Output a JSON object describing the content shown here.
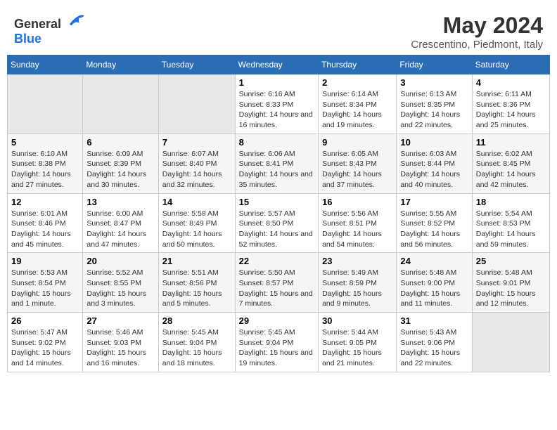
{
  "header": {
    "logo_general": "General",
    "logo_blue": "Blue",
    "title": "May 2024",
    "subtitle": "Crescentino, Piedmont, Italy"
  },
  "weekdays": [
    "Sunday",
    "Monday",
    "Tuesday",
    "Wednesday",
    "Thursday",
    "Friday",
    "Saturday"
  ],
  "weeks": [
    [
      {
        "day": "",
        "empty": true
      },
      {
        "day": "",
        "empty": true
      },
      {
        "day": "",
        "empty": true
      },
      {
        "day": "1",
        "sunrise": "6:16 AM",
        "sunset": "8:33 PM",
        "daylight": "14 hours and 16 minutes."
      },
      {
        "day": "2",
        "sunrise": "6:14 AM",
        "sunset": "8:34 PM",
        "daylight": "14 hours and 19 minutes."
      },
      {
        "day": "3",
        "sunrise": "6:13 AM",
        "sunset": "8:35 PM",
        "daylight": "14 hours and 22 minutes."
      },
      {
        "day": "4",
        "sunrise": "6:11 AM",
        "sunset": "8:36 PM",
        "daylight": "14 hours and 25 minutes."
      }
    ],
    [
      {
        "day": "5",
        "sunrise": "6:10 AM",
        "sunset": "8:38 PM",
        "daylight": "14 hours and 27 minutes."
      },
      {
        "day": "6",
        "sunrise": "6:09 AM",
        "sunset": "8:39 PM",
        "daylight": "14 hours and 30 minutes."
      },
      {
        "day": "7",
        "sunrise": "6:07 AM",
        "sunset": "8:40 PM",
        "daylight": "14 hours and 32 minutes."
      },
      {
        "day": "8",
        "sunrise": "6:06 AM",
        "sunset": "8:41 PM",
        "daylight": "14 hours and 35 minutes."
      },
      {
        "day": "9",
        "sunrise": "6:05 AM",
        "sunset": "8:43 PM",
        "daylight": "14 hours and 37 minutes."
      },
      {
        "day": "10",
        "sunrise": "6:03 AM",
        "sunset": "8:44 PM",
        "daylight": "14 hours and 40 minutes."
      },
      {
        "day": "11",
        "sunrise": "6:02 AM",
        "sunset": "8:45 PM",
        "daylight": "14 hours and 42 minutes."
      }
    ],
    [
      {
        "day": "12",
        "sunrise": "6:01 AM",
        "sunset": "8:46 PM",
        "daylight": "14 hours and 45 minutes."
      },
      {
        "day": "13",
        "sunrise": "6:00 AM",
        "sunset": "8:47 PM",
        "daylight": "14 hours and 47 minutes."
      },
      {
        "day": "14",
        "sunrise": "5:58 AM",
        "sunset": "8:49 PM",
        "daylight": "14 hours and 50 minutes."
      },
      {
        "day": "15",
        "sunrise": "5:57 AM",
        "sunset": "8:50 PM",
        "daylight": "14 hours and 52 minutes."
      },
      {
        "day": "16",
        "sunrise": "5:56 AM",
        "sunset": "8:51 PM",
        "daylight": "14 hours and 54 minutes."
      },
      {
        "day": "17",
        "sunrise": "5:55 AM",
        "sunset": "8:52 PM",
        "daylight": "14 hours and 56 minutes."
      },
      {
        "day": "18",
        "sunrise": "5:54 AM",
        "sunset": "8:53 PM",
        "daylight": "14 hours and 59 minutes."
      }
    ],
    [
      {
        "day": "19",
        "sunrise": "5:53 AM",
        "sunset": "8:54 PM",
        "daylight": "15 hours and 1 minute."
      },
      {
        "day": "20",
        "sunrise": "5:52 AM",
        "sunset": "8:55 PM",
        "daylight": "15 hours and 3 minutes."
      },
      {
        "day": "21",
        "sunrise": "5:51 AM",
        "sunset": "8:56 PM",
        "daylight": "15 hours and 5 minutes."
      },
      {
        "day": "22",
        "sunrise": "5:50 AM",
        "sunset": "8:57 PM",
        "daylight": "15 hours and 7 minutes."
      },
      {
        "day": "23",
        "sunrise": "5:49 AM",
        "sunset": "8:59 PM",
        "daylight": "15 hours and 9 minutes."
      },
      {
        "day": "24",
        "sunrise": "5:48 AM",
        "sunset": "9:00 PM",
        "daylight": "15 hours and 11 minutes."
      },
      {
        "day": "25",
        "sunrise": "5:48 AM",
        "sunset": "9:01 PM",
        "daylight": "15 hours and 12 minutes."
      }
    ],
    [
      {
        "day": "26",
        "sunrise": "5:47 AM",
        "sunset": "9:02 PM",
        "daylight": "15 hours and 14 minutes."
      },
      {
        "day": "27",
        "sunrise": "5:46 AM",
        "sunset": "9:03 PM",
        "daylight": "15 hours and 16 minutes."
      },
      {
        "day": "28",
        "sunrise": "5:45 AM",
        "sunset": "9:04 PM",
        "daylight": "15 hours and 18 minutes."
      },
      {
        "day": "29",
        "sunrise": "5:45 AM",
        "sunset": "9:04 PM",
        "daylight": "15 hours and 19 minutes."
      },
      {
        "day": "30",
        "sunrise": "5:44 AM",
        "sunset": "9:05 PM",
        "daylight": "15 hours and 21 minutes."
      },
      {
        "day": "31",
        "sunrise": "5:43 AM",
        "sunset": "9:06 PM",
        "daylight": "15 hours and 22 minutes."
      },
      {
        "day": "",
        "empty": true
      }
    ]
  ]
}
